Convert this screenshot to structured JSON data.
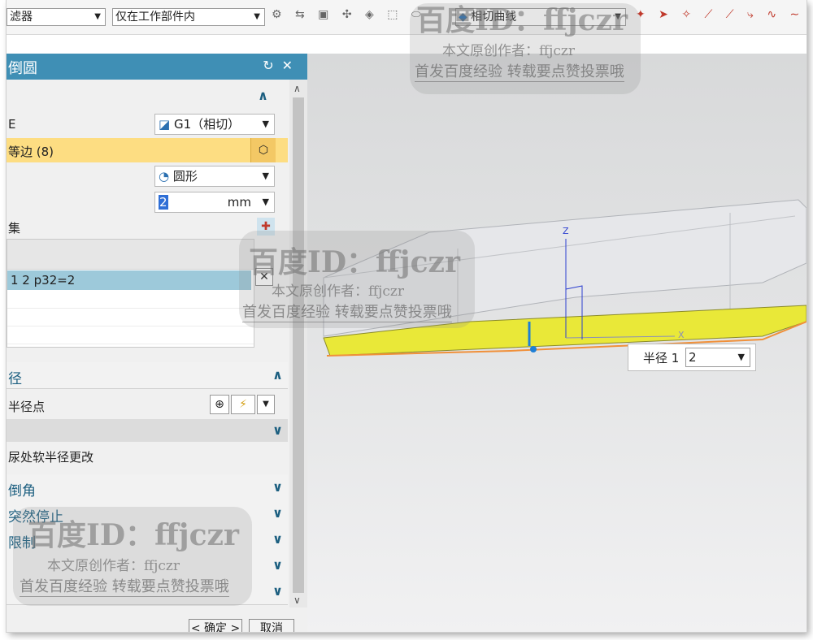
{
  "toolbar": {
    "filter_combo": "滤器",
    "scope_combo": "仅在工作部件内",
    "curve_combo": "相切曲线"
  },
  "dialog": {
    "title": "倒圆",
    "reset_glyph": "↻",
    "close_glyph": "✕",
    "row_continuity_label": "E",
    "continuity_value": "G1（相切）",
    "edges_label": "等边 (8)",
    "shape_value": "圆形",
    "radius_value": "2",
    "radius_unit": "mm",
    "set_label": "集",
    "list_selected": "1 2 p32=2",
    "section_variable": "径",
    "variable_points_label": "半径点",
    "corner_label": "尿处软半径更改",
    "section_corner": "倒角",
    "section_stop": "突然停止",
    "section_limit": "限制",
    "ok_button": "< 确定 >",
    "cancel_button": "取消"
  },
  "viewport": {
    "axis_z": "Z",
    "axis_x": "X",
    "radius_popup_label": "半径 1",
    "radius_popup_value": "2"
  },
  "watermarks": {
    "id_text": "百度ID：ffjczr",
    "author_text": "本文原创作者：ffjczr",
    "promo_text": "首发百度经验 转载要点赞投票哦"
  }
}
